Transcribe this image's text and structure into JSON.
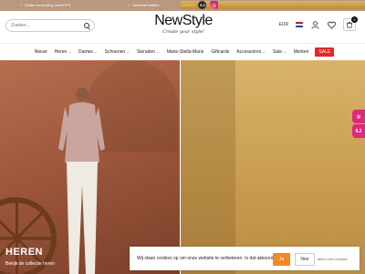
{
  "topbar": {
    "usps": [
      "Gratis verzending vanaf €75",
      "Achteraf betalen",
      "Bel ons direct: +31 (0) 000 123 45 67"
    ],
    "rating_score": "9.2",
    "rating_label": "★★★★★"
  },
  "header": {
    "search_placeholder": "Zoeken...",
    "logo_name": "NewStyle",
    "logo_tagline": "Create your style!",
    "currency": "EUR",
    "cart_count": "0"
  },
  "nav": {
    "items": [
      "Nieuw",
      "Heren",
      "Dames",
      "Schoenen",
      "Sieraden",
      "Marie-Stella-Maris",
      "Giftcards",
      "Accessoires",
      "Sale",
      "Merken"
    ],
    "sale_label": "SALE"
  },
  "hero": {
    "title": "HEREN",
    "subtitle": "Bekijk de collectie heren"
  },
  "side_tab_text": "9.2",
  "cookie": {
    "text": "Wij slaan cookies op om onze website te verbeteren. Is dat akkoord?",
    "accept_label": "Ja",
    "decline_label": "Nee",
    "more_label": "Meer over cookies"
  },
  "colors": {
    "topbar": "#b8987e",
    "sale": "#e3262a",
    "accept": "#f08a24",
    "side_tab": "#e0287c"
  }
}
